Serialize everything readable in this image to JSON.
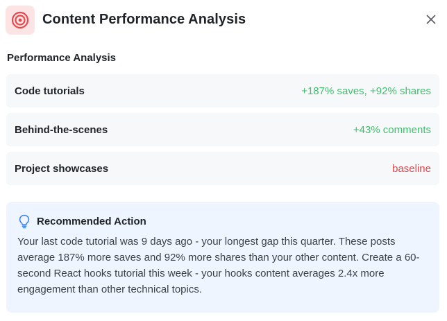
{
  "header": {
    "title": "Content Performance Analysis",
    "icon": "target-icon",
    "icon_bg": "#fde4e4",
    "icon_color": "#e5484d"
  },
  "section": {
    "title": "Performance Analysis"
  },
  "rows": [
    {
      "label": "Code tutorials",
      "value": "+187% saves, +92% shares",
      "status": "positive"
    },
    {
      "label": "Behind-the-scenes",
      "value": "+43% comments",
      "status": "positive"
    },
    {
      "label": "Project showcases",
      "value": "baseline",
      "status": "baseline"
    }
  ],
  "recommendation": {
    "icon": "lightbulb-icon",
    "title": "Recommended Action",
    "body": "Your last code tutorial was 9 days ago - your longest gap this quarter. These posts average 187% more saves and 92% more shares than your other content. Create a 60-second React hooks tutorial this week - your hooks content averages 2.4x more engagement than other technical topics."
  },
  "colors": {
    "positive": "#3fbf6e",
    "baseline": "#e5484d",
    "row_bg": "#f7f8fa",
    "recommendation_bg": "#eef5ff",
    "accent_blue": "#3b82f6"
  }
}
